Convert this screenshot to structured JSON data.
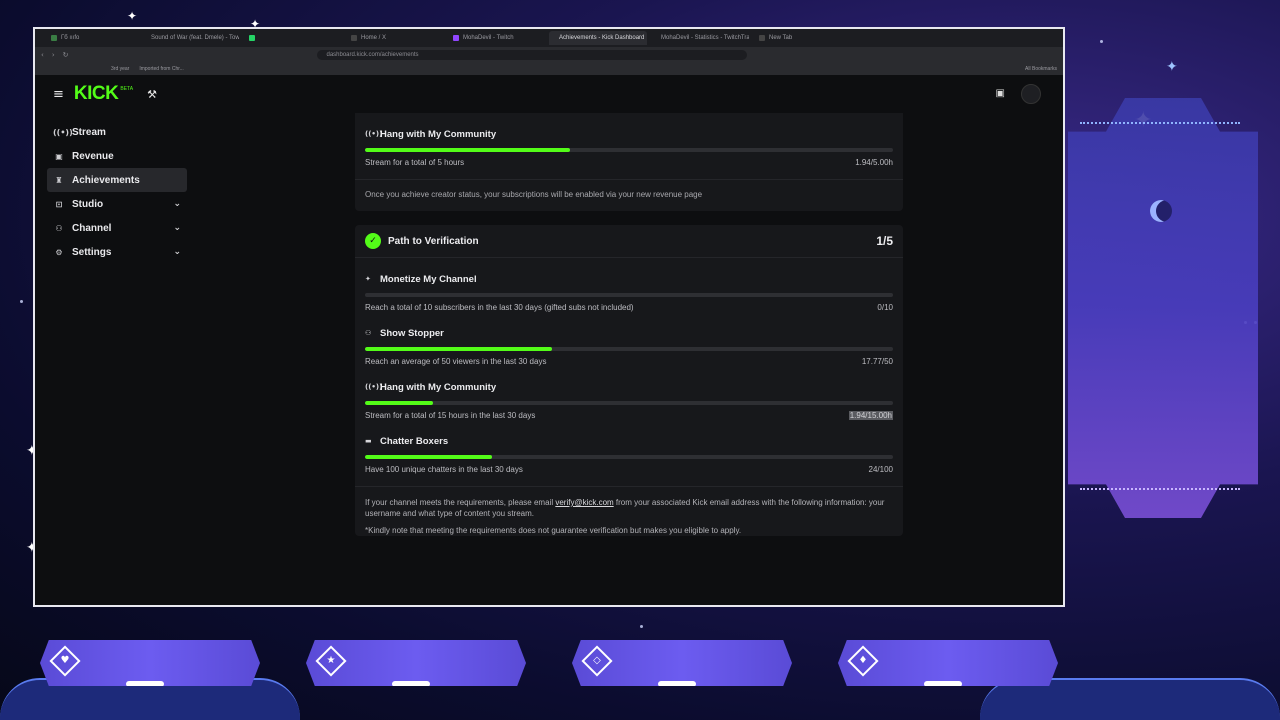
{
  "browser": {
    "tabs": [
      {
        "label": "Гб ıııfo",
        "color": "#3a7d44",
        "active": false
      },
      {
        "label": "Sound of War (feat. Dmele) - Tower",
        "color": "#c0392b",
        "active": false
      },
      {
        "label": "",
        "color": "#25d366",
        "active": false
      },
      {
        "label": "Home / X",
        "color": "#444444",
        "active": false
      },
      {
        "label": "MohaDevil - Twitch",
        "color": "#9146ff",
        "active": false
      },
      {
        "label": "Achievements - Kick Dashboard",
        "color": "#53fc18",
        "active": true
      },
      {
        "label": "MohaDevil - Statistics - TwitchTracker",
        "color": "#2fc48d",
        "active": false
      },
      {
        "label": "New Tab",
        "color": "#444444",
        "active": false
      }
    ],
    "address": "dashboard.kick.com/achievements",
    "bookmarks": [
      "3rd year",
      "Imported from Chr...",
      "All Bookmarks"
    ]
  },
  "header": {
    "logo": "KICK",
    "beta": "BETA"
  },
  "sidebar": {
    "items": [
      {
        "label": "Stream",
        "icon": "broadcast-icon",
        "glyph": "((•))",
        "active": false,
        "chevron": false
      },
      {
        "label": "Revenue",
        "icon": "revenue-icon",
        "glyph": "▣",
        "active": false,
        "chevron": false
      },
      {
        "label": "Achievements",
        "icon": "trophy-icon",
        "glyph": "♜",
        "active": true,
        "chevron": false
      },
      {
        "label": "Studio",
        "icon": "studio-icon",
        "glyph": "⊡",
        "active": false,
        "chevron": true
      },
      {
        "label": "Channel",
        "icon": "channel-icon",
        "glyph": "⚇",
        "active": false,
        "chevron": true
      },
      {
        "label": "Settings",
        "icon": "gear-icon",
        "glyph": "⚙",
        "active": false,
        "chevron": true
      }
    ]
  },
  "creator": {
    "achievement": {
      "title": "Hang with My Community",
      "description": "Stream for a total of 5 hours",
      "progress": "1.94/5.00h",
      "fraction": 0.388
    },
    "note": "Once you achieve creator status, your subscriptions will be enabled via your new revenue page"
  },
  "verification": {
    "title": "Path to Verification",
    "count": "1/5",
    "achievements": [
      {
        "title": "Monetize My Channel",
        "icon": "sparkle-icon",
        "glyph": "✦",
        "description": "Reach a total of 10 subscribers in the last 30 days (gifted subs not included)",
        "progress": "0/10",
        "fraction": 0.0,
        "highlight": false
      },
      {
        "title": "Show Stopper",
        "icon": "viewers-icon",
        "glyph": "⚇",
        "description": "Reach an average of 50 viewers in the last 30 days",
        "progress": "17.77/50",
        "fraction": 0.355,
        "highlight": false
      },
      {
        "title": "Hang with My Community",
        "icon": "broadcast-icon",
        "glyph": "((•))",
        "description": "Stream for a total of 15 hours in the last 30 days",
        "progress": "1.94/15.00h",
        "fraction": 0.129,
        "highlight": true
      },
      {
        "title": "Chatter Boxers",
        "icon": "chat-icon",
        "glyph": "▬",
        "description": "Have 100 unique chatters in the last 30 days",
        "progress": "24/100",
        "fraction": 0.24,
        "highlight": false
      }
    ],
    "body_pre": "If your channel meets the requirements, please email ",
    "email": "verify@kick.com",
    "body_post": " from your associated Kick email address with the following information: your username and what type of content you stream.",
    "disclaimer": "*Kindly note that meeting the requirements does not guarantee verification but makes you eligible to apply."
  },
  "overlay": {
    "buttons": [
      {
        "icon": "heart-icon",
        "glyph": "♥"
      },
      {
        "icon": "star-icon",
        "glyph": "★"
      },
      {
        "icon": "diamond-icon",
        "glyph": "◇"
      },
      {
        "icon": "drop-icon",
        "glyph": "♦"
      }
    ]
  },
  "colors": {
    "kick_green": "#53fc18",
    "bg_dark": "#0d0e10",
    "card": "#17181b",
    "overlay_purple": "#6c5cf0"
  }
}
